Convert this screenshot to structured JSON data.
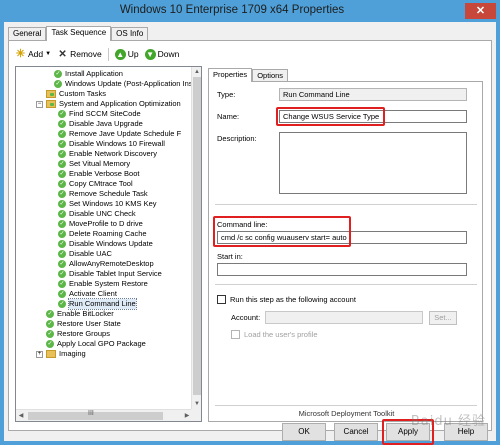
{
  "window": {
    "title": "Windows 10 Enterprise 1709 x64 Properties",
    "close_glyph": "✕"
  },
  "tabs": [
    "General",
    "Task Sequence",
    "OS Info"
  ],
  "toolbar": {
    "add": "Add",
    "remove": "Remove",
    "up": "Up",
    "down": "Down"
  },
  "tree": {
    "items": [
      "Install Application",
      "Windows Update (Post-Application Ins",
      "Custom Tasks",
      "System and Application Optimization",
      "Find SCCM SiteCode",
      "Disable Java Upgrade",
      "Remove Jave Update Schedule F",
      "Disable Windows 10 Firewall",
      "Enable Network Discovery",
      "Set Vitual Memory",
      "Enable Verbose Boot",
      "Copy CMtrace Tool",
      "Remove Schedule Task",
      "Set Windows 10 KMS Key",
      "Disable UNC Check",
      "MoveProfile to D drive",
      "Delete Roaming Cache",
      "Disable Windows Update",
      "Disable UAC",
      "AllowAnyRemoteDesktop",
      "Disable Tablet Input Service",
      "Enable System Restore",
      "Activate Client",
      "Run Command Line",
      "Enable BitLocker",
      "Restore User State",
      "Restore Groups",
      "Apply Local GPO Package",
      "Imaging"
    ],
    "expand_plus": "+",
    "expand_minus": "−",
    "scroll_thumb_label": "III",
    "scroll_up": "▲",
    "scroll_down": "▼",
    "scroll_left": "◀",
    "scroll_right": "▶"
  },
  "properties": {
    "tabs": [
      "Properties",
      "Options"
    ],
    "type_label": "Type:",
    "type_value": "Run Command Line",
    "name_label": "Name:",
    "name_value": "Change WSUS Service Type",
    "description_label": "Description:",
    "command_label": "Command line:",
    "command_value": "cmd /c sc config wuauserv start= auto",
    "start_in_label": "Start in:",
    "run_as_label": "Run this step as the following account",
    "account_label": "Account:",
    "set_button": "Set...",
    "load_profile_label": "Load the user's profile",
    "footer": "Microsoft Deployment Toolkit"
  },
  "buttons": {
    "ok": "OK",
    "cancel": "Cancel",
    "apply": "Apply",
    "help": "Help"
  },
  "watermark": "Baidu 经验",
  "colors": {
    "titlebar": "#4fa0d8",
    "highlight": "#e02020",
    "success": "#5cb648",
    "close": "#c7483a"
  }
}
